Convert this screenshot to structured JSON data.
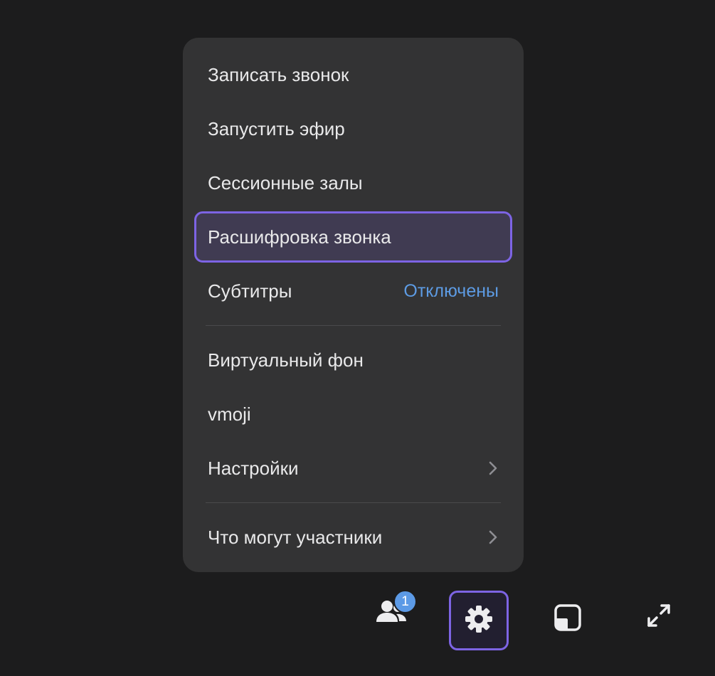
{
  "menu": {
    "items": [
      {
        "label": "Записать звонок"
      },
      {
        "label": "Запустить эфир"
      },
      {
        "label": "Сессионные залы"
      },
      {
        "label": "Расшифровка звонка",
        "selected": true
      },
      {
        "label": "Субтитры",
        "value": "Отключены"
      },
      {
        "label": "Виртуальный фон"
      },
      {
        "label": "vmoji"
      },
      {
        "label": "Настройки",
        "icon": "chevron-right-icon"
      },
      {
        "label": "Что могут участники",
        "icon": "chevron-right-icon"
      }
    ]
  },
  "toolbar": {
    "participants_badge": "1",
    "participants_icon": "people-icon",
    "settings_icon": "gear-icon",
    "layout_icon": "layout-icon",
    "fullscreen_icon": "expand-icon"
  },
  "colors": {
    "accent": "#7d64e4",
    "link": "#5d9be3",
    "menu_bg": "#333334",
    "page_bg": "#1c1c1d"
  }
}
